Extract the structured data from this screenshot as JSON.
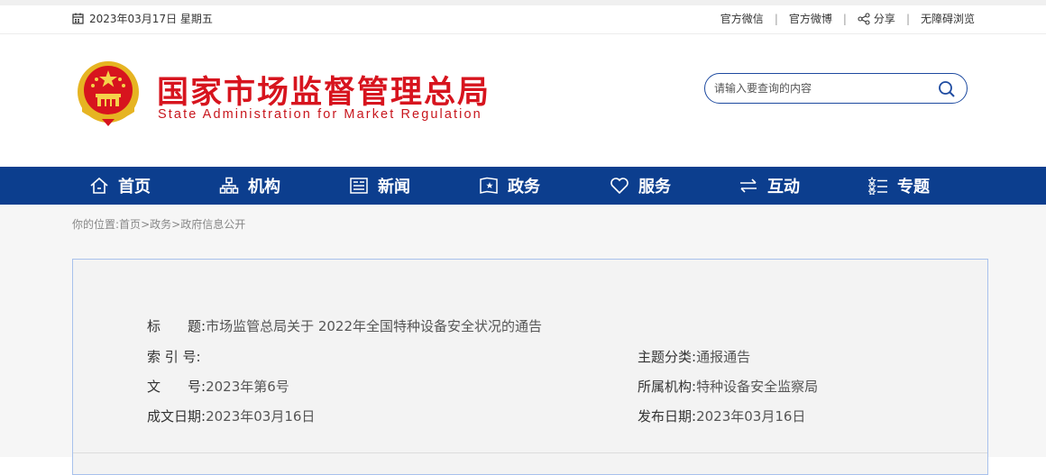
{
  "topbar": {
    "date": "2023年03月17日 星期五",
    "links": [
      "官方微信",
      "官方微博",
      "分享",
      "无障碍浏览"
    ]
  },
  "header": {
    "title": "国家市场监督管理总局",
    "subtitle": "State Administration for Market Regulation",
    "emblem": "national-emblem",
    "search_placeholder": "请输入要查询的内容"
  },
  "nav": {
    "items": [
      {
        "label": "首页",
        "icon": "home-icon"
      },
      {
        "label": "机构",
        "icon": "org-icon"
      },
      {
        "label": "新闻",
        "icon": "news-icon"
      },
      {
        "label": "政务",
        "icon": "affairs-icon"
      },
      {
        "label": "服务",
        "icon": "heart-icon"
      },
      {
        "label": "互动",
        "icon": "exchange-icon"
      },
      {
        "label": "专题",
        "icon": "topic-icon"
      }
    ]
  },
  "breadcrumb": {
    "prefix": "你的位置:",
    "items": [
      "首页",
      "政务",
      "政府信息公开"
    ],
    "sep": ">"
  },
  "info": {
    "title_label": "标　　题:",
    "title_value": "市场监管总局关于 2022年全国特种设备安全状况的通告",
    "index_label": "索 引 号:",
    "index_value": "",
    "doc_label": "文　　号:",
    "doc_value": "2023年第6号",
    "created_label": "成文日期:",
    "created_value": "2023年03月16日",
    "category_label": "主题分类:",
    "category_value": "通报通告",
    "org_label": "所属机构:",
    "org_value": "特种设备安全监察局",
    "published_label": "发布日期:",
    "published_value": "2023年03月16日"
  },
  "colors": {
    "nav": "#0c3e8e",
    "brand_red": "#d7141e",
    "card_border": "#a8c1ec"
  }
}
